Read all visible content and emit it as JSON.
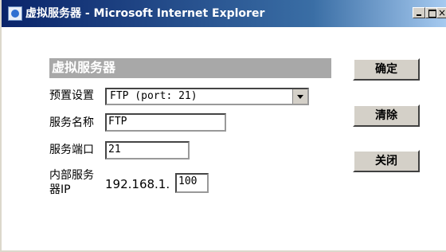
{
  "window": {
    "title": "虚拟服务器 - Microsoft Internet Explorer",
    "controls": {
      "minimize": "_",
      "maximize": "□",
      "close": "×"
    }
  },
  "panel": {
    "section_title": "虚拟服务器",
    "preset_label": "预置设置",
    "preset_value": "FTP (port: 21)",
    "service_name_label": "服务名称",
    "service_name_value": "FTP",
    "service_port_label": "服务端口",
    "service_port_value": "21",
    "internal_server_label_line1": "内部服务",
    "internal_server_label_line2": "器IP",
    "ip_prefix": "192.168.1.",
    "ip_last_octet": "100"
  },
  "buttons": {
    "confirm": "确定",
    "clear": "清除",
    "close": "关闭"
  }
}
